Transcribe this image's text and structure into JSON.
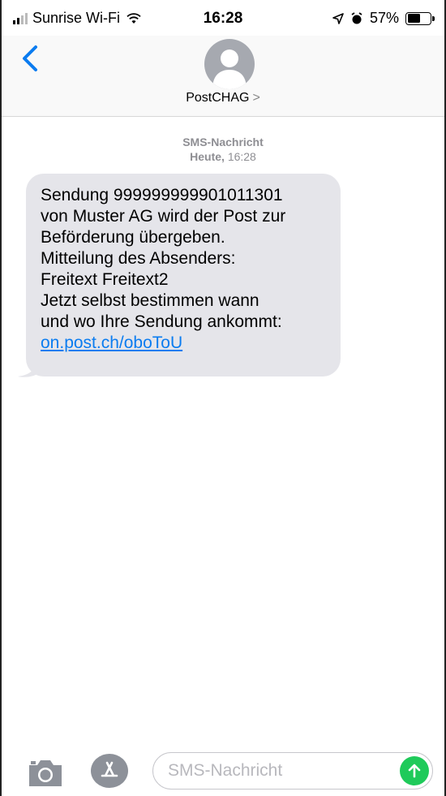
{
  "status_bar": {
    "carrier": "Sunrise Wi-Fi",
    "time": "16:28",
    "battery": "57%",
    "battery_level": 0.57
  },
  "header": {
    "contact_name": "PostCHAG",
    "contact_chevron": ">",
    "back_icon": "chevron-left-icon",
    "avatar_icon": "person-silhouette-icon"
  },
  "thread": {
    "kind": "SMS-Nachricht",
    "date_label": "Heute,",
    "time": "16:28"
  },
  "message": {
    "lines": [
      "Sendung 999999999901011301",
      "von Muster AG wird der Post zur",
      "Beförderung übergeben.",
      "Mitteilung des Absenders:",
      "Freitext Freitext2",
      "Jetzt selbst bestimmen wann",
      "und wo Ihre Sendung ankommt:"
    ],
    "link": "on.post.ch/oboToU",
    "bubble_color": "#e5e5ea",
    "link_color": "#0a7cf0"
  },
  "input_bar": {
    "placeholder": "SMS-Nachricht",
    "camera_icon": "camera-icon",
    "appstore_icon": "app-store-icon",
    "send_icon": "send-arrow-icon",
    "send_color": "#1fca5a"
  }
}
